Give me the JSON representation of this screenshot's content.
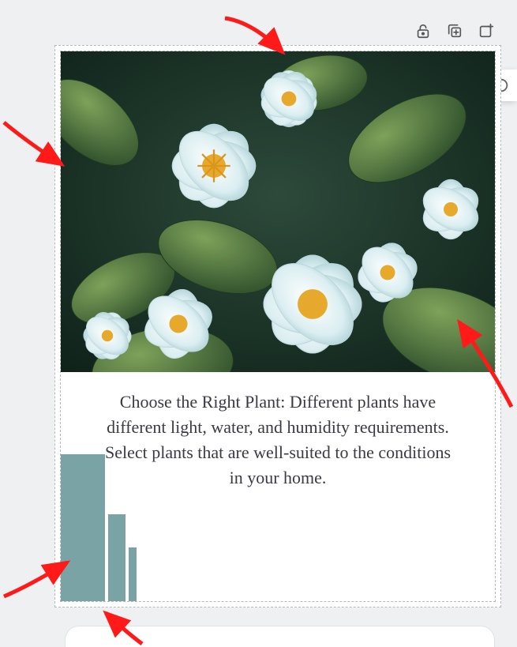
{
  "toolbar": {
    "lock_icon_name": "unlock-icon",
    "duplicate_icon_name": "copy-plus-icon",
    "add_icon_name": "add-panel-icon"
  },
  "card": {
    "caption": "Choose the Right Plant: Different plants have different light, water, and humidity requirements. Select plants that are well-suited to the conditions in your home.",
    "image_alt": "white flowers with green leaves"
  },
  "chart_data": {
    "type": "bar",
    "categories": [
      "",
      "",
      ""
    ],
    "values": [
      186,
      110,
      68
    ],
    "title": "",
    "xlabel": "",
    "ylabel": "",
    "ylim": [
      0,
      200
    ]
  },
  "annotations": {
    "count": 5
  }
}
